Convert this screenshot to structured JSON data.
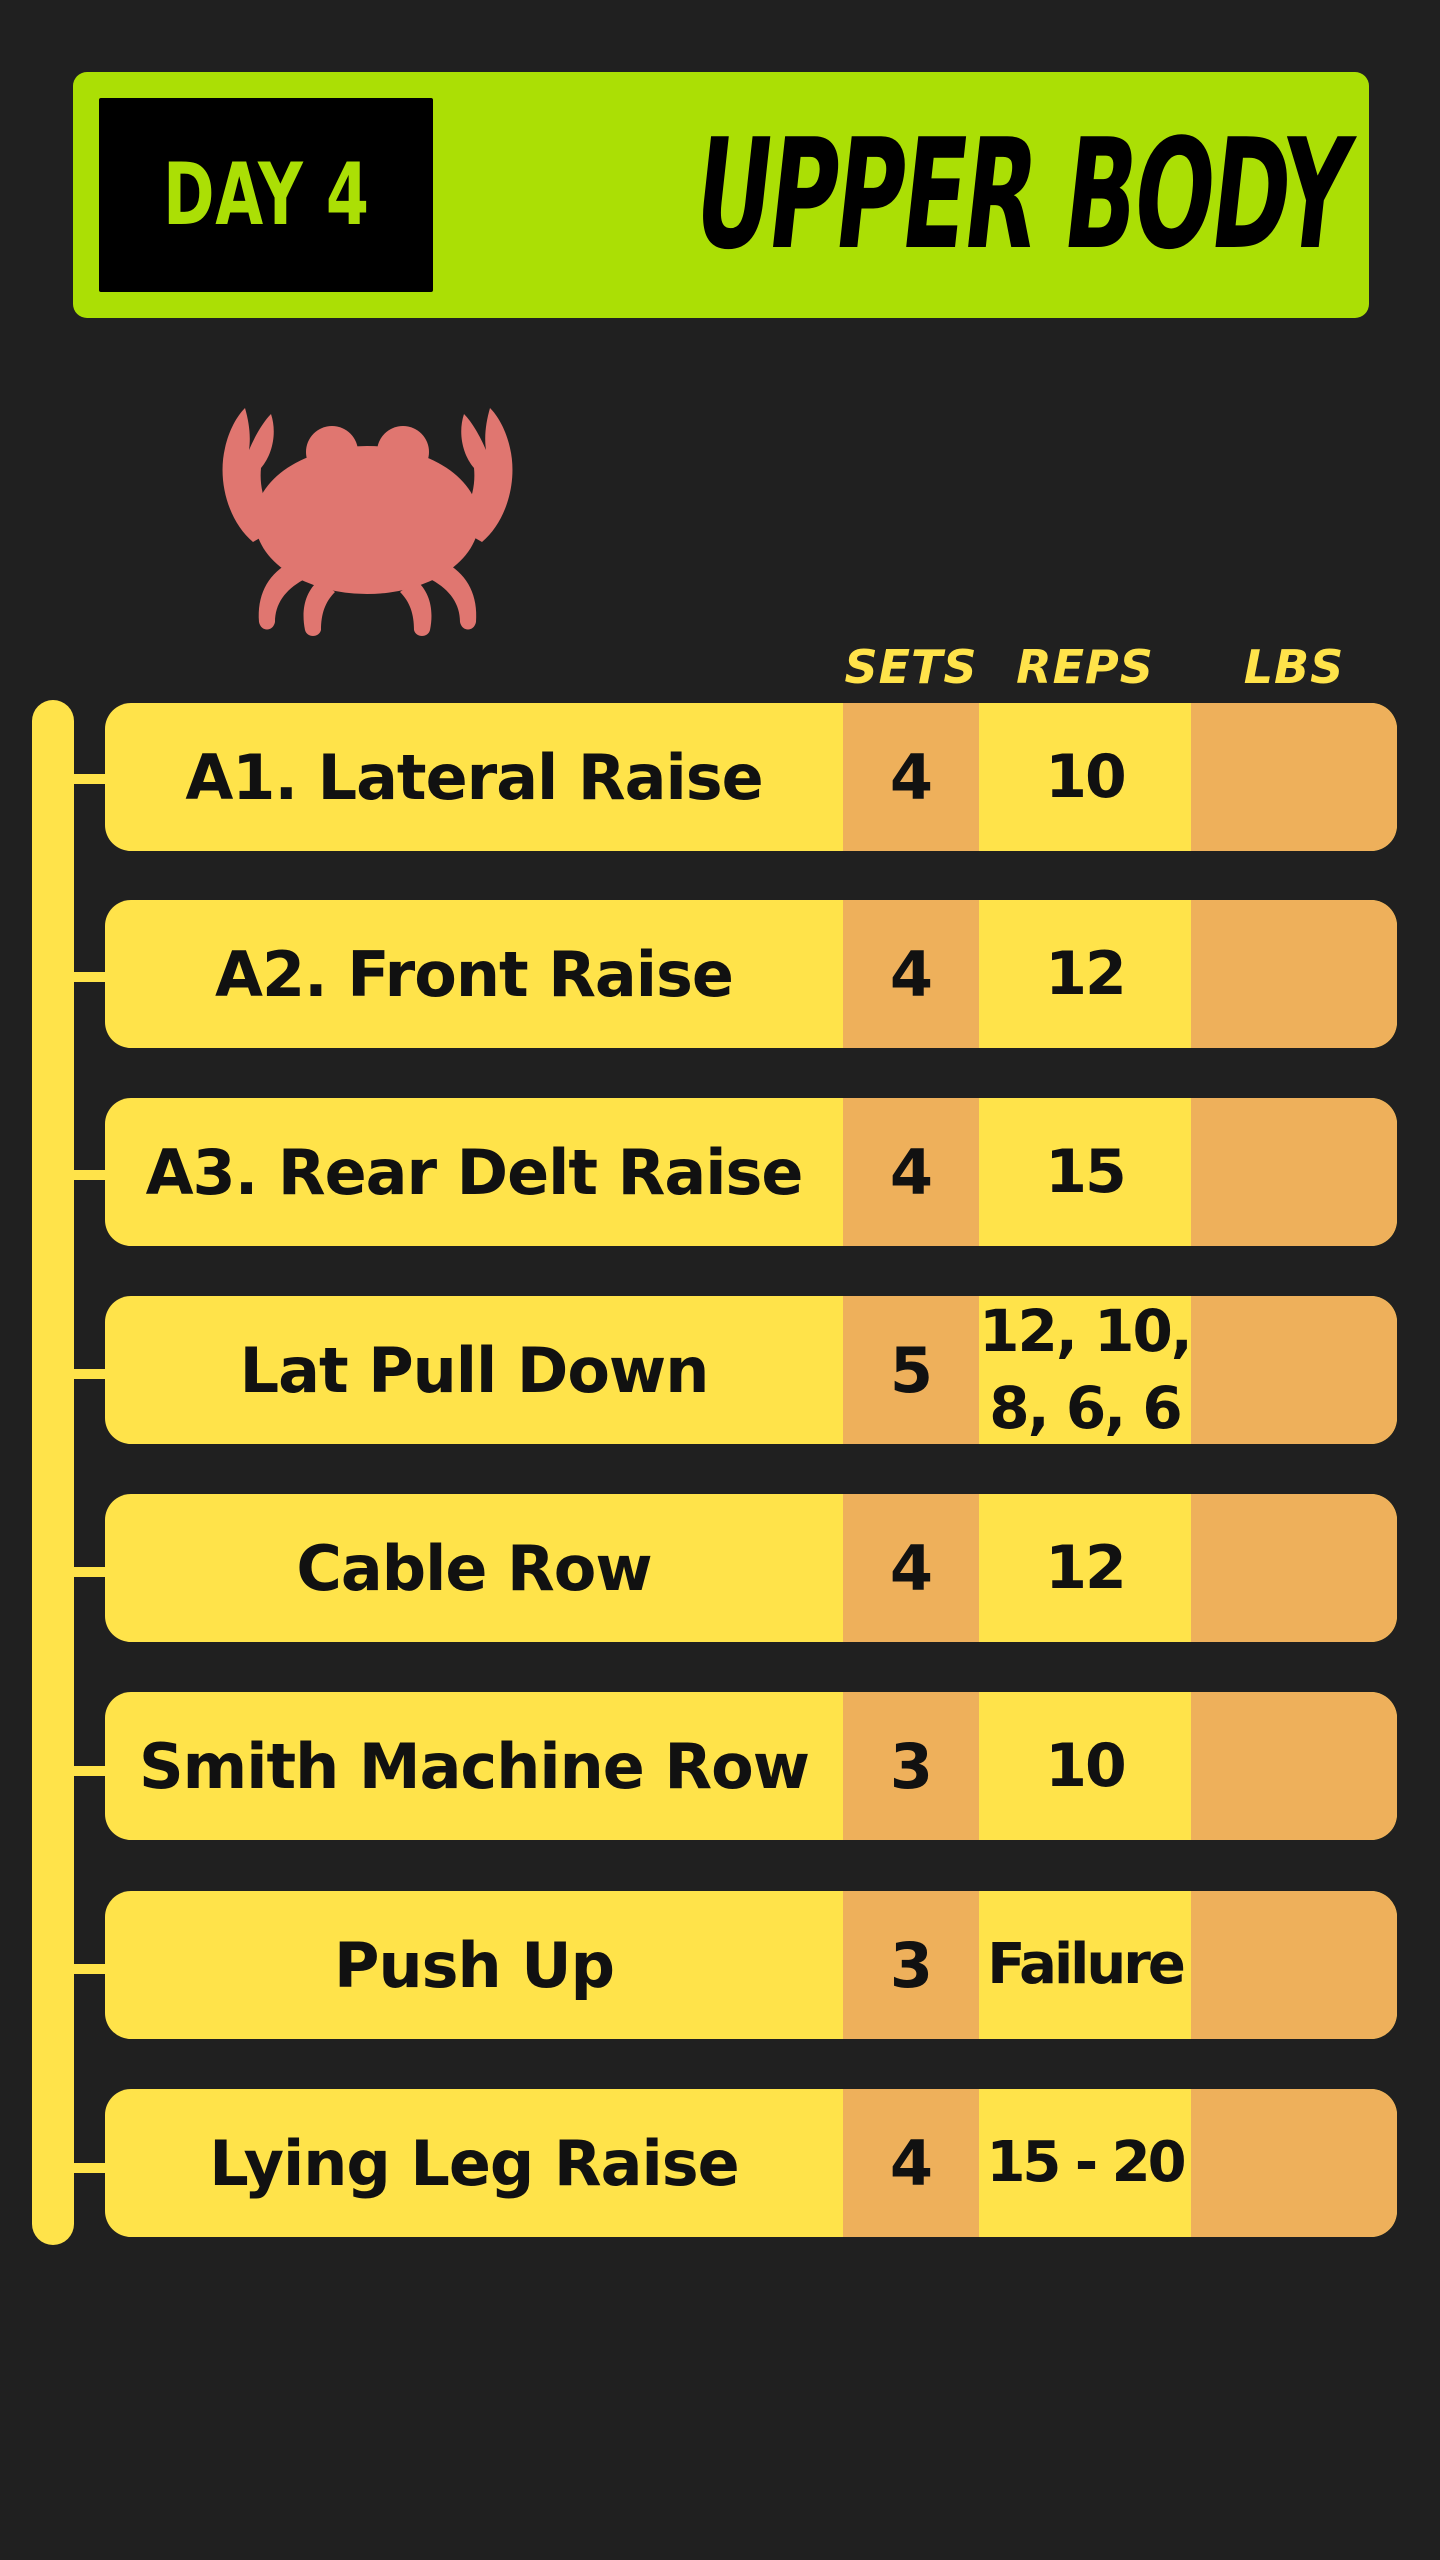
{
  "header": {
    "day_label": "DAY 4",
    "title": "UPPER BODY"
  },
  "icon": {
    "name": "crab-icon",
    "color": "#e07670"
  },
  "colors": {
    "background": "#202020",
    "banner": "#abdf05",
    "row_yellow": "#ffe34a",
    "row_orange": "#eeb05b",
    "header_text": "#ffe34a"
  },
  "columns": {
    "sets": "SETS",
    "reps": "REPS",
    "lbs": "LBS"
  },
  "exercises": [
    {
      "name": "A1. Lateral Raise",
      "sets": "4",
      "reps": "10",
      "lbs": ""
    },
    {
      "name": "A2. Front Raise",
      "sets": "4",
      "reps": "12",
      "lbs": ""
    },
    {
      "name": "A3. Rear Delt Raise",
      "sets": "4",
      "reps": "15",
      "lbs": ""
    },
    {
      "name": "Lat Pull Down",
      "sets": "5",
      "reps": "12, 10,\n8, 6, 6",
      "lbs": ""
    },
    {
      "name": "Cable Row",
      "sets": "4",
      "reps": "12",
      "lbs": ""
    },
    {
      "name": "Smith Machine Row",
      "sets": "3",
      "reps": "10",
      "lbs": ""
    },
    {
      "name": "Push Up",
      "sets": "3",
      "reps": "Failure",
      "lbs": ""
    },
    {
      "name": "Lying Leg Raise",
      "sets": "4",
      "reps": "15 - 20",
      "lbs": ""
    }
  ]
}
